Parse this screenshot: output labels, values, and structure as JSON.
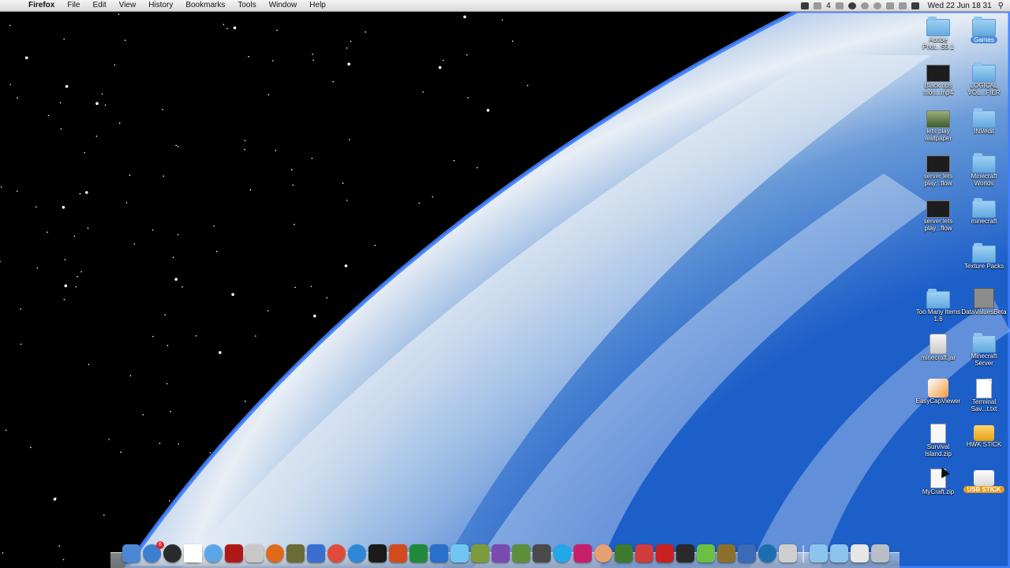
{
  "menubar": {
    "apple_icon": "apple-logo",
    "app_name": "Firefox",
    "menus": [
      "File",
      "Edit",
      "View",
      "History",
      "Bookmarks",
      "Tools",
      "Window",
      "Help"
    ],
    "status": {
      "adobe_count": "4",
      "clock": "Wed 22 Jun  18 31",
      "icons": [
        "camera-icon",
        "adobe-updates-icon",
        "dropbox-icon",
        "skype-icon",
        "sync-icon",
        "time-machine-icon",
        "bluetooth-icon",
        "wifi-icon",
        "volume-icon",
        "spotlight-icon"
      ]
    }
  },
  "desktop": {
    "icons": [
      {
        "label": "Adobe Phot...S5.1",
        "kind": "folder"
      },
      {
        "label": "Games",
        "kind": "folder",
        "selected": true
      },
      {
        "label": "Black ops mon...mp4",
        "kind": "video"
      },
      {
        "label": "LOGICAL VOL...FIER",
        "kind": "folder"
      },
      {
        "label": "lets play wallpaper",
        "kind": "image"
      },
      {
        "label": "INVedit",
        "kind": "folder"
      },
      {
        "label": "server lets play...flow",
        "kind": "video"
      },
      {
        "label": "Minecraft Worlds",
        "kind": "folder"
      },
      {
        "label": "server lets play...flow",
        "kind": "video"
      },
      {
        "label": "minecraft",
        "kind": "folder"
      },
      {
        "label": "Texture Packs",
        "kind": "folder"
      },
      {
        "label": "Too Many Items 1.6",
        "kind": "folder"
      },
      {
        "label": "DataValuesBeta",
        "kind": "image"
      },
      {
        "label": "minecraft.jar",
        "kind": "jar"
      },
      {
        "label": "Minecraft Server",
        "kind": "folder"
      },
      {
        "label": "EasyCapViewer",
        "kind": "app"
      },
      {
        "label": "Terminal Sav...t.txt",
        "kind": "document"
      },
      {
        "label": "Survival Island.zip",
        "kind": "zip"
      },
      {
        "label": "HWK STICK",
        "kind": "drive"
      },
      {
        "label": "MyCraft.zip",
        "kind": "zip"
      },
      {
        "label": "USB STICK",
        "kind": "drive",
        "badge": true
      }
    ]
  },
  "dock": {
    "calendar_day": "22",
    "mail_badge": "6",
    "apps": [
      {
        "name": "finder",
        "color": "#4a88d6"
      },
      {
        "name": "mail",
        "color": "#3c7fd0"
      },
      {
        "name": "dashboard",
        "color": "#2b2b2b"
      },
      {
        "name": "ical",
        "color": "#ffffff"
      },
      {
        "name": "safari",
        "color": "#5aa6e8"
      },
      {
        "name": "photo-booth",
        "color": "#b01818"
      },
      {
        "name": "preview",
        "color": "#c8c8c8"
      },
      {
        "name": "firefox",
        "color": "#e06a1a"
      },
      {
        "name": "utility",
        "color": "#6b6b35"
      },
      {
        "name": "bluetooth",
        "color": "#3a6fd0"
      },
      {
        "name": "chrome",
        "color": "#e04a3a"
      },
      {
        "name": "itunes",
        "color": "#2d86d8"
      },
      {
        "name": "terminal",
        "color": "#1b1b1b"
      },
      {
        "name": "powerpoint",
        "color": "#d24b1f"
      },
      {
        "name": "excel",
        "color": "#1e8a3a"
      },
      {
        "name": "word",
        "color": "#2a6fc9"
      },
      {
        "name": "snowflake",
        "color": "#6fc6f0"
      },
      {
        "name": "xcode",
        "color": "#7d9a3d"
      },
      {
        "name": "imovie",
        "color": "#7a4ab0"
      },
      {
        "name": "minecraft",
        "color": "#5d8f3a"
      },
      {
        "name": "server",
        "color": "#4a4a4a"
      },
      {
        "name": "skype",
        "color": "#22a8e8"
      },
      {
        "name": "butterfly",
        "color": "#c81f6b"
      },
      {
        "name": "face",
        "color": "#e7a071"
      },
      {
        "name": "tree",
        "color": "#3d7a2e"
      },
      {
        "name": "stamps",
        "color": "#d03b3b"
      },
      {
        "name": "angry-birds",
        "color": "#c82020"
      },
      {
        "name": "activity",
        "color": "#2a2a2a"
      },
      {
        "name": "leaf",
        "color": "#6ac043"
      },
      {
        "name": "sticky",
        "color": "#8c6f2b"
      },
      {
        "name": "glider",
        "color": "#3b6bb7"
      },
      {
        "name": "globe",
        "color": "#1b6fb0"
      },
      {
        "name": "dvd",
        "color": "#cfcfcf"
      }
    ],
    "stacks": [
      {
        "name": "applications-stack",
        "color": "#8cc4ee"
      },
      {
        "name": "documents-stack",
        "color": "#8cc4ee"
      },
      {
        "name": "downloads-stack",
        "color": "#e6e6e6"
      },
      {
        "name": "trash",
        "color": "#b8bfc6"
      }
    ]
  }
}
